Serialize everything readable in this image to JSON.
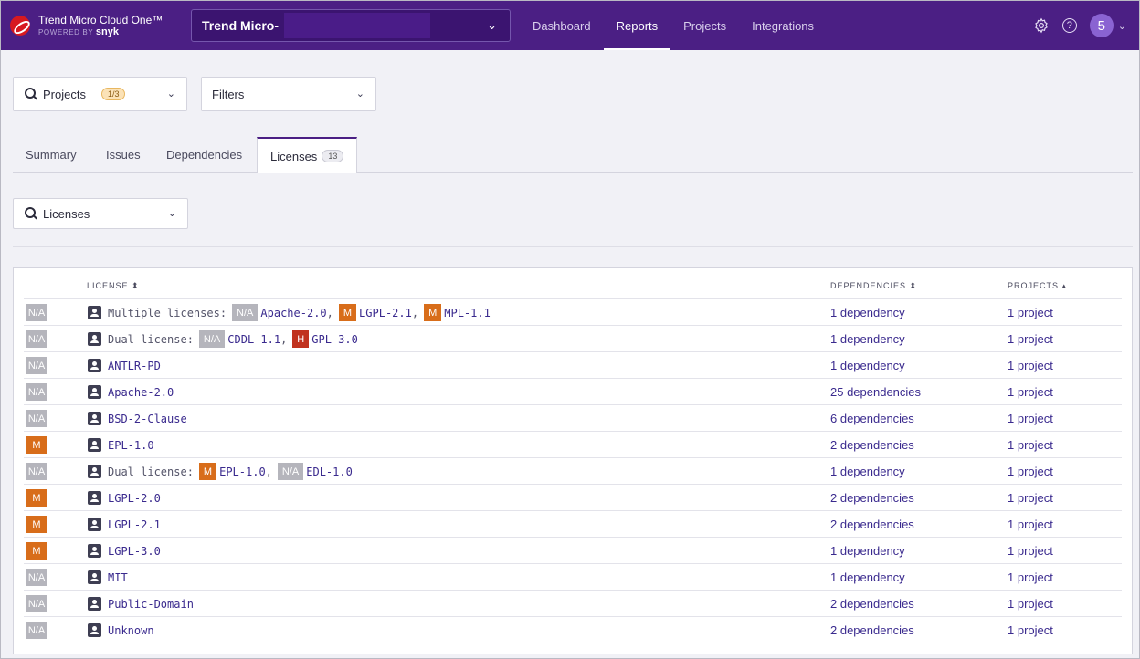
{
  "brand": {
    "name": "Trend Micro Cloud One™",
    "powered_by": "POWERED BY",
    "powered_brand": "snyk"
  },
  "org": {
    "name": "Trend Micro-"
  },
  "nav": [
    "Dashboard",
    "Reports",
    "Projects",
    "Integrations"
  ],
  "nav_active": "Reports",
  "user": {
    "initial": "5"
  },
  "icons": {
    "settings": "gear-icon",
    "help": "question-circle-icon",
    "search": "search-icon",
    "license": "license-badge-icon"
  },
  "colors": {
    "topbar": "#4b1f84",
    "medium": "#d86d1a",
    "high": "#c0321e",
    "na": "#b5b5bc",
    "link": "#3a2a8e"
  },
  "filters": {
    "projects_label": "Projects",
    "projects_count": "1/3",
    "filters_label": "Filters"
  },
  "tabs": [
    {
      "label": "Summary"
    },
    {
      "label": "Issues"
    },
    {
      "label": "Dependencies"
    },
    {
      "label": "Licenses",
      "badge": "13"
    }
  ],
  "licenses_search": {
    "label": "Licenses"
  },
  "table": {
    "headers": {
      "license": "LICENSE ⬍",
      "dependencies": "DEPENDENCIES ⬍",
      "projects": "PROJECTS ▴"
    },
    "rows": [
      {
        "severity": "N/A",
        "prefix": "Multiple licenses:",
        "parts": [
          {
            "sev": "N/A",
            "name": "Apache-2.0",
            "sep": ","
          },
          {
            "sev": "M",
            "name": "LGPL-2.1",
            "sep": ","
          },
          {
            "sev": "M",
            "name": "MPL-1.1",
            "sep": ""
          }
        ],
        "dependencies": "1 dependency",
        "projects": "1 project"
      },
      {
        "severity": "N/A",
        "prefix": "Dual license:",
        "parts": [
          {
            "sev": "N/A",
            "name": "CDDL-1.1",
            "sep": ","
          },
          {
            "sev": "H",
            "name": "GPL-3.0",
            "sep": ""
          }
        ],
        "dependencies": "1 dependency",
        "projects": "1 project"
      },
      {
        "severity": "N/A",
        "name": "ANTLR-PD",
        "dependencies": "1 dependency",
        "projects": "1 project"
      },
      {
        "severity": "N/A",
        "name": "Apache-2.0",
        "dependencies": "25 dependencies",
        "projects": "1 project"
      },
      {
        "severity": "N/A",
        "name": "BSD-2-Clause",
        "dependencies": "6 dependencies",
        "projects": "1 project"
      },
      {
        "severity": "M",
        "name": "EPL-1.0",
        "dependencies": "2 dependencies",
        "projects": "1 project"
      },
      {
        "severity": "N/A",
        "prefix": "Dual license:",
        "parts": [
          {
            "sev": "M",
            "name": "EPL-1.0",
            "sep": ","
          },
          {
            "sev": "N/A",
            "name": "EDL-1.0",
            "sep": ""
          }
        ],
        "dependencies": "1 dependency",
        "projects": "1 project"
      },
      {
        "severity": "M",
        "name": "LGPL-2.0",
        "dependencies": "2 dependencies",
        "projects": "1 project"
      },
      {
        "severity": "M",
        "name": "LGPL-2.1",
        "dependencies": "2 dependencies",
        "projects": "1 project"
      },
      {
        "severity": "M",
        "name": "LGPL-3.0",
        "dependencies": "1 dependency",
        "projects": "1 project"
      },
      {
        "severity": "N/A",
        "name": "MIT",
        "dependencies": "1 dependency",
        "projects": "1 project"
      },
      {
        "severity": "N/A",
        "name": "Public-Domain",
        "dependencies": "2 dependencies",
        "projects": "1 project"
      },
      {
        "severity": "N/A",
        "name": "Unknown",
        "dependencies": "2 dependencies",
        "projects": "1 project"
      }
    ]
  }
}
